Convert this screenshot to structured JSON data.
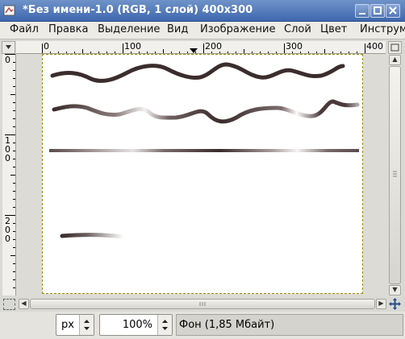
{
  "window": {
    "title": "*Без имени-1.0 (RGB, 1 слой) 400x300",
    "buttons": [
      "minimize",
      "maximize",
      "close"
    ]
  },
  "menu": {
    "items": [
      "Файл",
      "Правка",
      "Выделение",
      "Вид",
      "Изображение",
      "Слой",
      "Цвет",
      "Инструм"
    ]
  },
  "rulers": {
    "horizontal_labels": [
      "0",
      "100",
      "200",
      "300",
      "400"
    ],
    "vertical_labels": [
      "0",
      "100",
      "200"
    ]
  },
  "statusbar": {
    "unit": "px",
    "zoom": "100%",
    "info": "Фон (1,85 Мбайт)"
  },
  "colors": {
    "titlebar": "#4a70b4",
    "stroke": "#3a2a2a",
    "selection_border": "#9b8a00"
  },
  "icons": [
    "gimp-app-icon",
    "minimize-icon",
    "maximize-icon",
    "close-icon",
    "navigate-icon",
    "quick-mask-icon"
  ]
}
